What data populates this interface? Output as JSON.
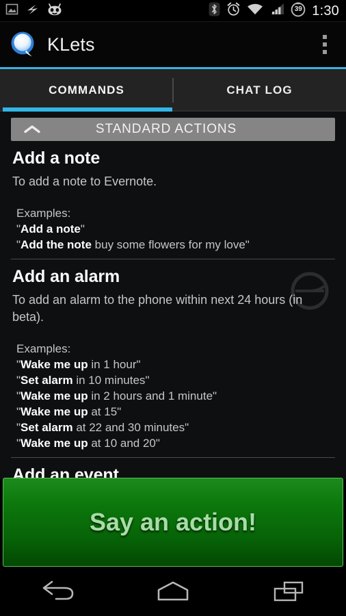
{
  "status_bar": {
    "left_icons": [
      "screenshot-icon",
      "lightning-bolt-icon",
      "cyanogenmod-icon"
    ],
    "right_icons": [
      "bluetooth-icon",
      "alarm-icon",
      "wifi-icon",
      "signal-icon"
    ],
    "battery_level": "39",
    "clock": "1:30"
  },
  "action_bar": {
    "logo": "klets-speech-bubble-logo",
    "title": "KLets",
    "overflow": "overflow-menu-icon"
  },
  "tabs": [
    {
      "label": "COMMANDS",
      "active": true
    },
    {
      "label": "CHAT LOG",
      "active": false
    }
  ],
  "section": {
    "title": "STANDARD ACTIONS",
    "collapse_icon": "chevron-up-icon",
    "expanded": true
  },
  "commands": [
    {
      "title": "Add a note",
      "description": "To add a note to Evernote.",
      "examples_label": "Examples:",
      "examples": [
        {
          "trigger": "Add a note",
          "rest": ""
        },
        {
          "trigger": "Add the note",
          "rest": " buy some flowers for my love"
        }
      ]
    },
    {
      "title": "Add an alarm",
      "description": "To add an alarm to the phone within next 24 hours (in beta).",
      "examples_label": "Examples:",
      "watermark_icon": "alarm-clock-watermark-icon",
      "examples": [
        {
          "trigger": "Wake me up",
          "rest": " in 1 hour"
        },
        {
          "trigger": "Set alarm",
          "rest": " in 10 minutes"
        },
        {
          "trigger": "Wake me up",
          "rest": " in 2 hours and 1 minute"
        },
        {
          "trigger": "Wake me up",
          "rest": " at 15"
        },
        {
          "trigger": "Set alarm",
          "rest": " at 22 and 30 minutes"
        },
        {
          "trigger": "Wake me up",
          "rest": " at 10 and 20"
        }
      ]
    },
    {
      "title": "Add an event",
      "description": "",
      "examples_label": "",
      "examples": []
    }
  ],
  "say_action_button": {
    "label": "Say an action!"
  },
  "nav_bar": {
    "back": "back-icon",
    "home": "home-icon",
    "recents": "recents-icon"
  },
  "colors": {
    "accent": "#33b5e5",
    "button_green": "#0c780c",
    "button_text_green": "#a7dca7",
    "section_header_gray": "#858585",
    "list_background": "#0d0f11"
  }
}
